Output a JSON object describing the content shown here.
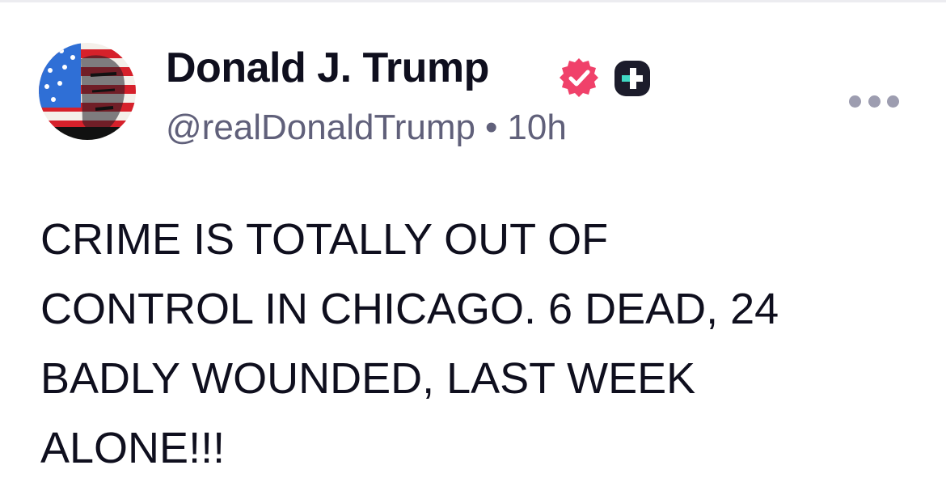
{
  "post": {
    "author": {
      "display_name": "Donald J. Trump",
      "handle": "@realDonaldTrump",
      "separator": "•",
      "time_ago": "10h",
      "verified_icon": "verified-badge-icon",
      "badge_icon": "plus-badge-icon",
      "avatar_icon": "avatar-portrait-flag"
    },
    "more_icon": "more-options-icon",
    "body_lines": [
      "CRIME IS TOTALLY OUT OF",
      "CONTROL IN CHICAGO. 6 DEAD, 24",
      "BADLY WOUNDED, LAST WEEK",
      "ALONE!!!"
    ]
  },
  "colors": {
    "verified": "#f0416a",
    "badge": "#1c1c2b",
    "badge_accent": "#41d9c4",
    "secondary_text": "#60607a",
    "more_dots": "#9d9db0"
  }
}
